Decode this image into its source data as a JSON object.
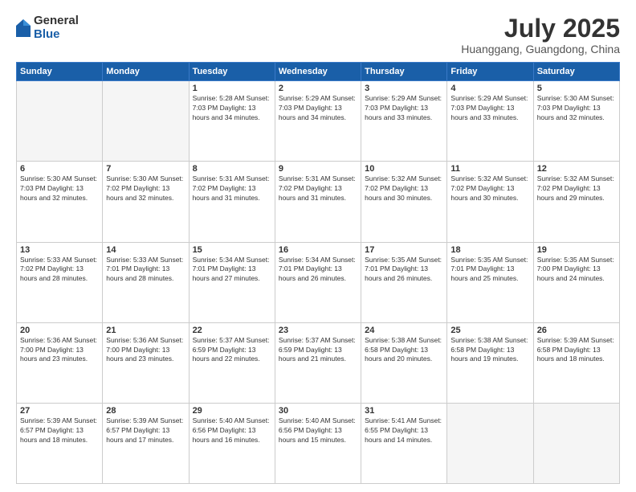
{
  "header": {
    "logo_general": "General",
    "logo_blue": "Blue",
    "month_title": "July 2025",
    "location": "Huanggang, Guangdong, China"
  },
  "days_of_week": [
    "Sunday",
    "Monday",
    "Tuesday",
    "Wednesday",
    "Thursday",
    "Friday",
    "Saturday"
  ],
  "weeks": [
    [
      {
        "day": "",
        "info": ""
      },
      {
        "day": "",
        "info": ""
      },
      {
        "day": "1",
        "info": "Sunrise: 5:28 AM\nSunset: 7:03 PM\nDaylight: 13 hours and 34 minutes."
      },
      {
        "day": "2",
        "info": "Sunrise: 5:29 AM\nSunset: 7:03 PM\nDaylight: 13 hours and 34 minutes."
      },
      {
        "day": "3",
        "info": "Sunrise: 5:29 AM\nSunset: 7:03 PM\nDaylight: 13 hours and 33 minutes."
      },
      {
        "day": "4",
        "info": "Sunrise: 5:29 AM\nSunset: 7:03 PM\nDaylight: 13 hours and 33 minutes."
      },
      {
        "day": "5",
        "info": "Sunrise: 5:30 AM\nSunset: 7:03 PM\nDaylight: 13 hours and 32 minutes."
      }
    ],
    [
      {
        "day": "6",
        "info": "Sunrise: 5:30 AM\nSunset: 7:03 PM\nDaylight: 13 hours and 32 minutes."
      },
      {
        "day": "7",
        "info": "Sunrise: 5:30 AM\nSunset: 7:02 PM\nDaylight: 13 hours and 32 minutes."
      },
      {
        "day": "8",
        "info": "Sunrise: 5:31 AM\nSunset: 7:02 PM\nDaylight: 13 hours and 31 minutes."
      },
      {
        "day": "9",
        "info": "Sunrise: 5:31 AM\nSunset: 7:02 PM\nDaylight: 13 hours and 31 minutes."
      },
      {
        "day": "10",
        "info": "Sunrise: 5:32 AM\nSunset: 7:02 PM\nDaylight: 13 hours and 30 minutes."
      },
      {
        "day": "11",
        "info": "Sunrise: 5:32 AM\nSunset: 7:02 PM\nDaylight: 13 hours and 30 minutes."
      },
      {
        "day": "12",
        "info": "Sunrise: 5:32 AM\nSunset: 7:02 PM\nDaylight: 13 hours and 29 minutes."
      }
    ],
    [
      {
        "day": "13",
        "info": "Sunrise: 5:33 AM\nSunset: 7:02 PM\nDaylight: 13 hours and 28 minutes."
      },
      {
        "day": "14",
        "info": "Sunrise: 5:33 AM\nSunset: 7:01 PM\nDaylight: 13 hours and 28 minutes."
      },
      {
        "day": "15",
        "info": "Sunrise: 5:34 AM\nSunset: 7:01 PM\nDaylight: 13 hours and 27 minutes."
      },
      {
        "day": "16",
        "info": "Sunrise: 5:34 AM\nSunset: 7:01 PM\nDaylight: 13 hours and 26 minutes."
      },
      {
        "day": "17",
        "info": "Sunrise: 5:35 AM\nSunset: 7:01 PM\nDaylight: 13 hours and 26 minutes."
      },
      {
        "day": "18",
        "info": "Sunrise: 5:35 AM\nSunset: 7:01 PM\nDaylight: 13 hours and 25 minutes."
      },
      {
        "day": "19",
        "info": "Sunrise: 5:35 AM\nSunset: 7:00 PM\nDaylight: 13 hours and 24 minutes."
      }
    ],
    [
      {
        "day": "20",
        "info": "Sunrise: 5:36 AM\nSunset: 7:00 PM\nDaylight: 13 hours and 23 minutes."
      },
      {
        "day": "21",
        "info": "Sunrise: 5:36 AM\nSunset: 7:00 PM\nDaylight: 13 hours and 23 minutes."
      },
      {
        "day": "22",
        "info": "Sunrise: 5:37 AM\nSunset: 6:59 PM\nDaylight: 13 hours and 22 minutes."
      },
      {
        "day": "23",
        "info": "Sunrise: 5:37 AM\nSunset: 6:59 PM\nDaylight: 13 hours and 21 minutes."
      },
      {
        "day": "24",
        "info": "Sunrise: 5:38 AM\nSunset: 6:58 PM\nDaylight: 13 hours and 20 minutes."
      },
      {
        "day": "25",
        "info": "Sunrise: 5:38 AM\nSunset: 6:58 PM\nDaylight: 13 hours and 19 minutes."
      },
      {
        "day": "26",
        "info": "Sunrise: 5:39 AM\nSunset: 6:58 PM\nDaylight: 13 hours and 18 minutes."
      }
    ],
    [
      {
        "day": "27",
        "info": "Sunrise: 5:39 AM\nSunset: 6:57 PM\nDaylight: 13 hours and 18 minutes."
      },
      {
        "day": "28",
        "info": "Sunrise: 5:39 AM\nSunset: 6:57 PM\nDaylight: 13 hours and 17 minutes."
      },
      {
        "day": "29",
        "info": "Sunrise: 5:40 AM\nSunset: 6:56 PM\nDaylight: 13 hours and 16 minutes."
      },
      {
        "day": "30",
        "info": "Sunrise: 5:40 AM\nSunset: 6:56 PM\nDaylight: 13 hours and 15 minutes."
      },
      {
        "day": "31",
        "info": "Sunrise: 5:41 AM\nSunset: 6:55 PM\nDaylight: 13 hours and 14 minutes."
      },
      {
        "day": "",
        "info": ""
      },
      {
        "day": "",
        "info": ""
      }
    ]
  ]
}
